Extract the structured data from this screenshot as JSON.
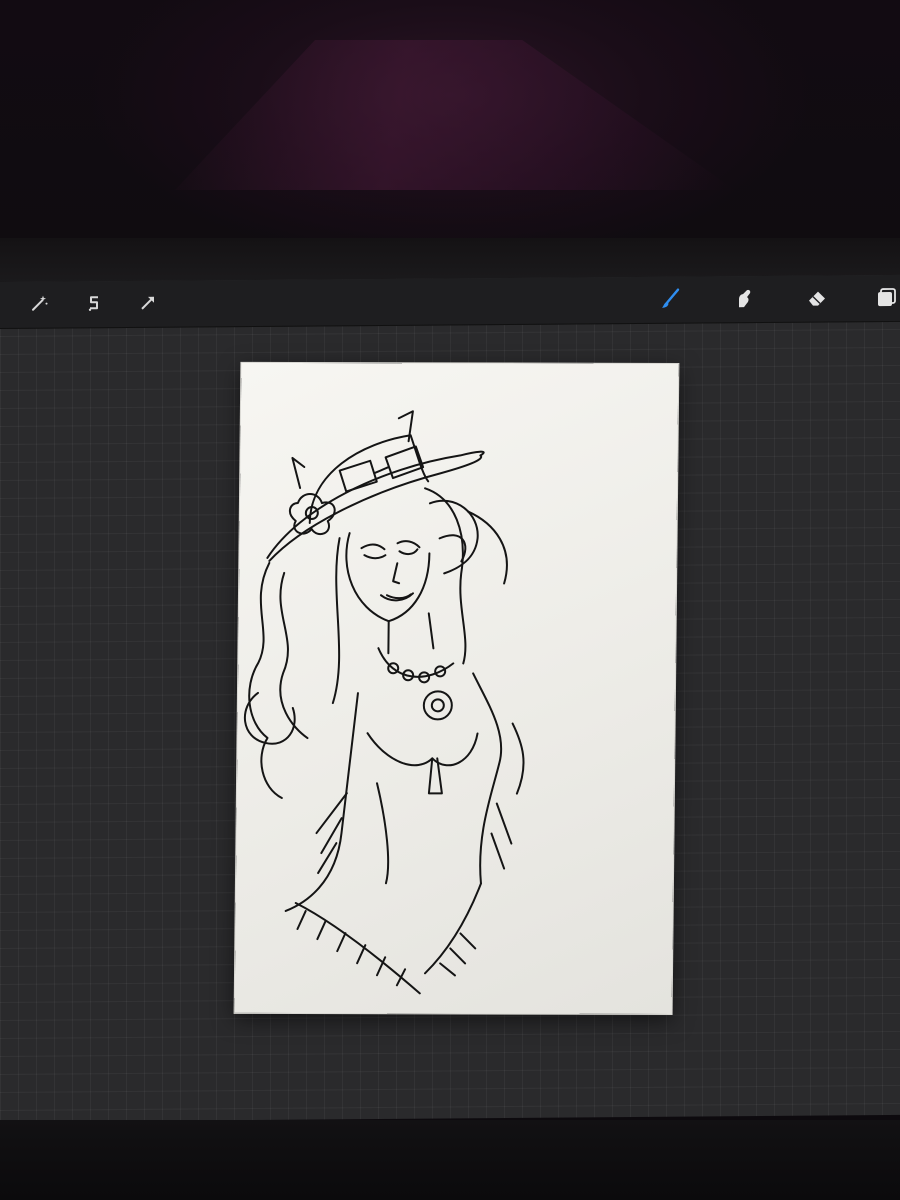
{
  "app": {
    "accent_color": "#2f8ef0",
    "toolbar": {
      "left_tools": [
        {
          "name": "adjustments",
          "icon": "magic-wand-icon"
        },
        {
          "name": "selection",
          "icon": "selection-s-icon"
        },
        {
          "name": "transform",
          "icon": "arrow-cursor-icon"
        }
      ],
      "right_tools": [
        {
          "name": "brush",
          "icon": "brush-icon",
          "active": true
        },
        {
          "name": "smudge",
          "icon": "smudge-finger-icon",
          "active": false
        },
        {
          "name": "eraser",
          "icon": "eraser-icon",
          "active": false
        },
        {
          "name": "layers",
          "icon": "layers-icon",
          "active": false
        }
      ]
    },
    "canvas": {
      "background_color": "#f3f2ee",
      "grid_color": "#3a3a3c",
      "artwork": "line-sketch"
    }
  }
}
